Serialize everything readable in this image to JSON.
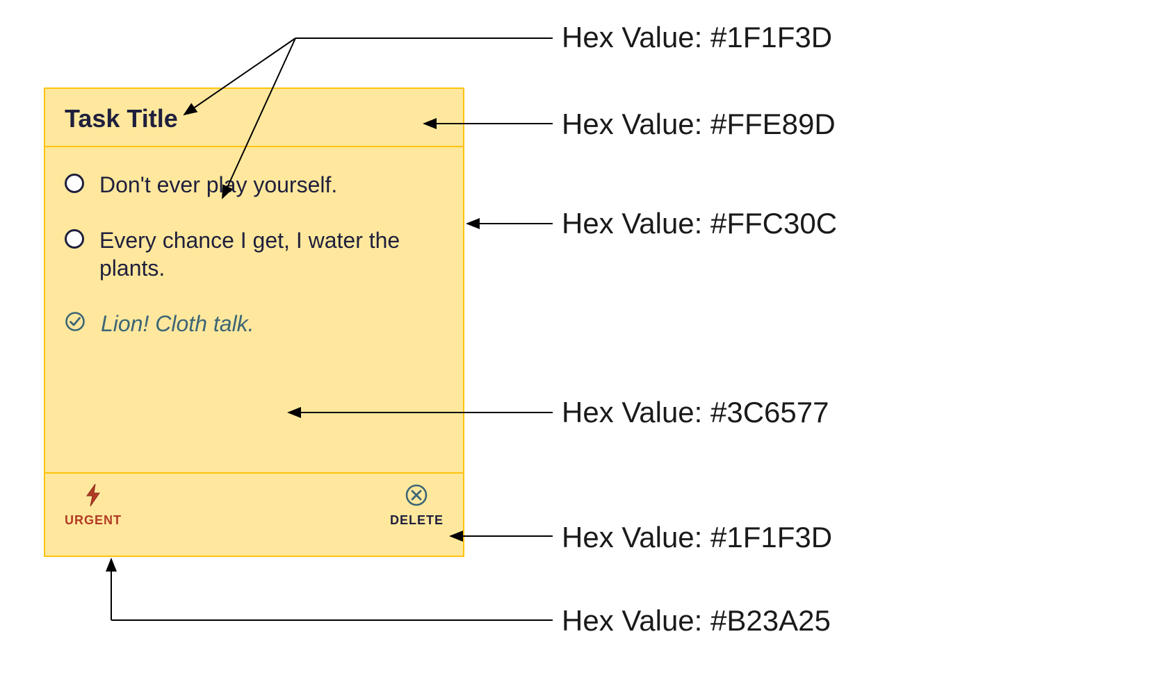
{
  "card": {
    "title": "Task Title",
    "items": [
      {
        "text": "Don't ever play yourself.",
        "completed": false
      },
      {
        "text": "Every chance I get, I water the plants.",
        "completed": false
      },
      {
        "text": "Lion! Cloth talk.",
        "completed": true
      }
    ],
    "footer": {
      "urgent_label": "URGENT",
      "delete_label": "DELETE"
    }
  },
  "annotations": [
    {
      "label": "Hex Value: #1F1F3D",
      "hex": "#1F1F3D",
      "target": "title-text"
    },
    {
      "label": "Hex Value: #FFE89D",
      "hex": "#FFE89D",
      "target": "card-background"
    },
    {
      "label": "Hex Value: #FFC30C",
      "hex": "#FFC30C",
      "target": "card-border"
    },
    {
      "label": "Hex Value: #3C6577",
      "hex": "#3C6577",
      "target": "completed-text"
    },
    {
      "label": "Hex Value: #1F1F3D",
      "hex": "#1F1F3D",
      "target": "delete-label"
    },
    {
      "label": "Hex Value: #B23A25",
      "hex": "#B23A25",
      "target": "urgent-label"
    }
  ],
  "colors": {
    "title_text": "#1F1F3D",
    "card_bg": "#FFE89D",
    "card_border": "#FFC30C",
    "completed_text": "#3C6577",
    "delete_label": "#1F1F3D",
    "urgent_label": "#B23A25"
  }
}
